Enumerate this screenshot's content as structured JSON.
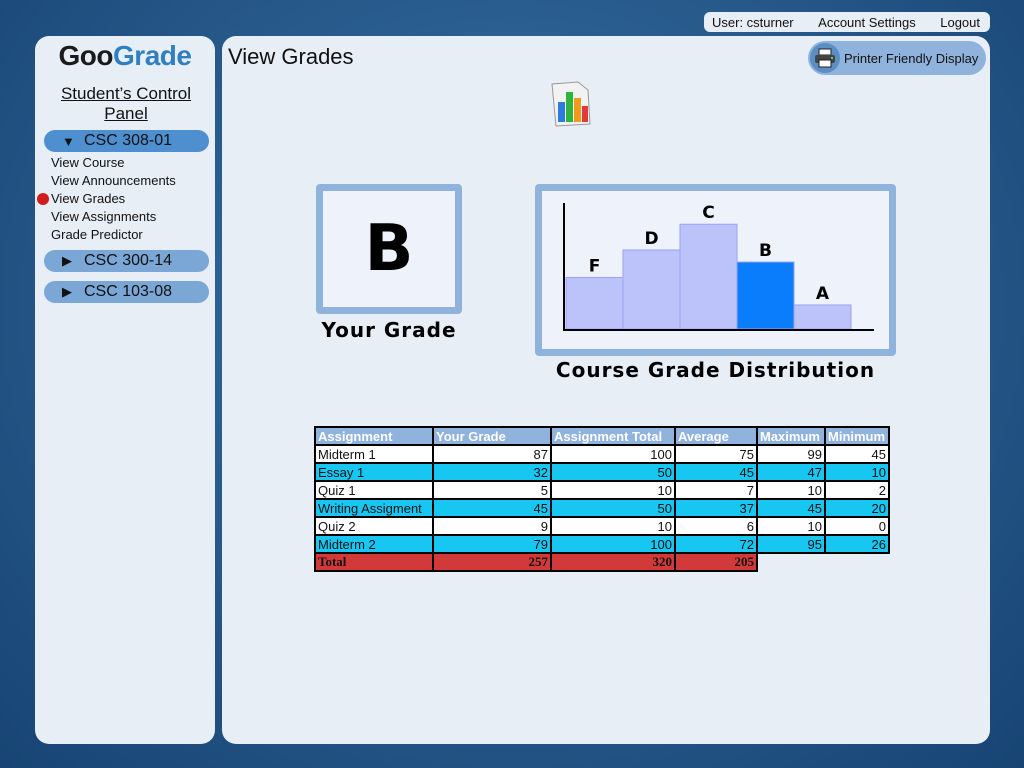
{
  "topnav": {
    "user": "User: csturner",
    "account_settings": "Account Settings",
    "logout": "Logout"
  },
  "logo": {
    "part1": "Goo",
    "part2": "Grade"
  },
  "sidebar": {
    "title": "Student’s Control Panel",
    "courses": [
      {
        "label": "CSC 308-01",
        "expanded": true,
        "arrow": "▼"
      },
      {
        "label": "CSC 300-14",
        "expanded": false,
        "arrow": "▶"
      },
      {
        "label": "CSC 103-08",
        "expanded": false,
        "arrow": "▶"
      }
    ],
    "submenu": [
      "View Course",
      "View Announcements",
      "View Grades",
      "View Assignments",
      "Grade Predictor"
    ],
    "active_item": "View Grades"
  },
  "main": {
    "title": "View Grades",
    "printer_label": "Printer Friendly Display",
    "your_grade": "B",
    "your_grade_caption": "Your Grade",
    "distribution_caption": "Course Grade Distribution"
  },
  "chart_data": {
    "type": "bar",
    "categories": [
      "F",
      "D",
      "C",
      "B",
      "A"
    ],
    "values": [
      3,
      4.6,
      6.1,
      3.9,
      1.4
    ],
    "highlight": "B",
    "colors": {
      "bar": "#bcc3fb",
      "highlight": "#0a7dfc"
    }
  },
  "table": {
    "headers": [
      "Assignment",
      "Your Grade",
      "Assignment Total",
      "Average",
      "Maximum",
      "Minimum"
    ],
    "rows": [
      [
        "Midterm 1",
        "87",
        "100",
        "75",
        "99",
        "45"
      ],
      [
        "Essay 1",
        "32",
        "50",
        "45",
        "47",
        "10"
      ],
      [
        "Quiz 1",
        "5",
        "10",
        "7",
        "10",
        "2"
      ],
      [
        "Writing Assigment",
        "45",
        "50",
        "37",
        "45",
        "20"
      ],
      [
        "Quiz 2",
        "9",
        "10",
        "6",
        "10",
        "0"
      ],
      [
        "Midterm 2",
        "79",
        "100",
        "72",
        "95",
        "26"
      ]
    ],
    "total": [
      "Total",
      "257",
      "320",
      "205"
    ]
  }
}
